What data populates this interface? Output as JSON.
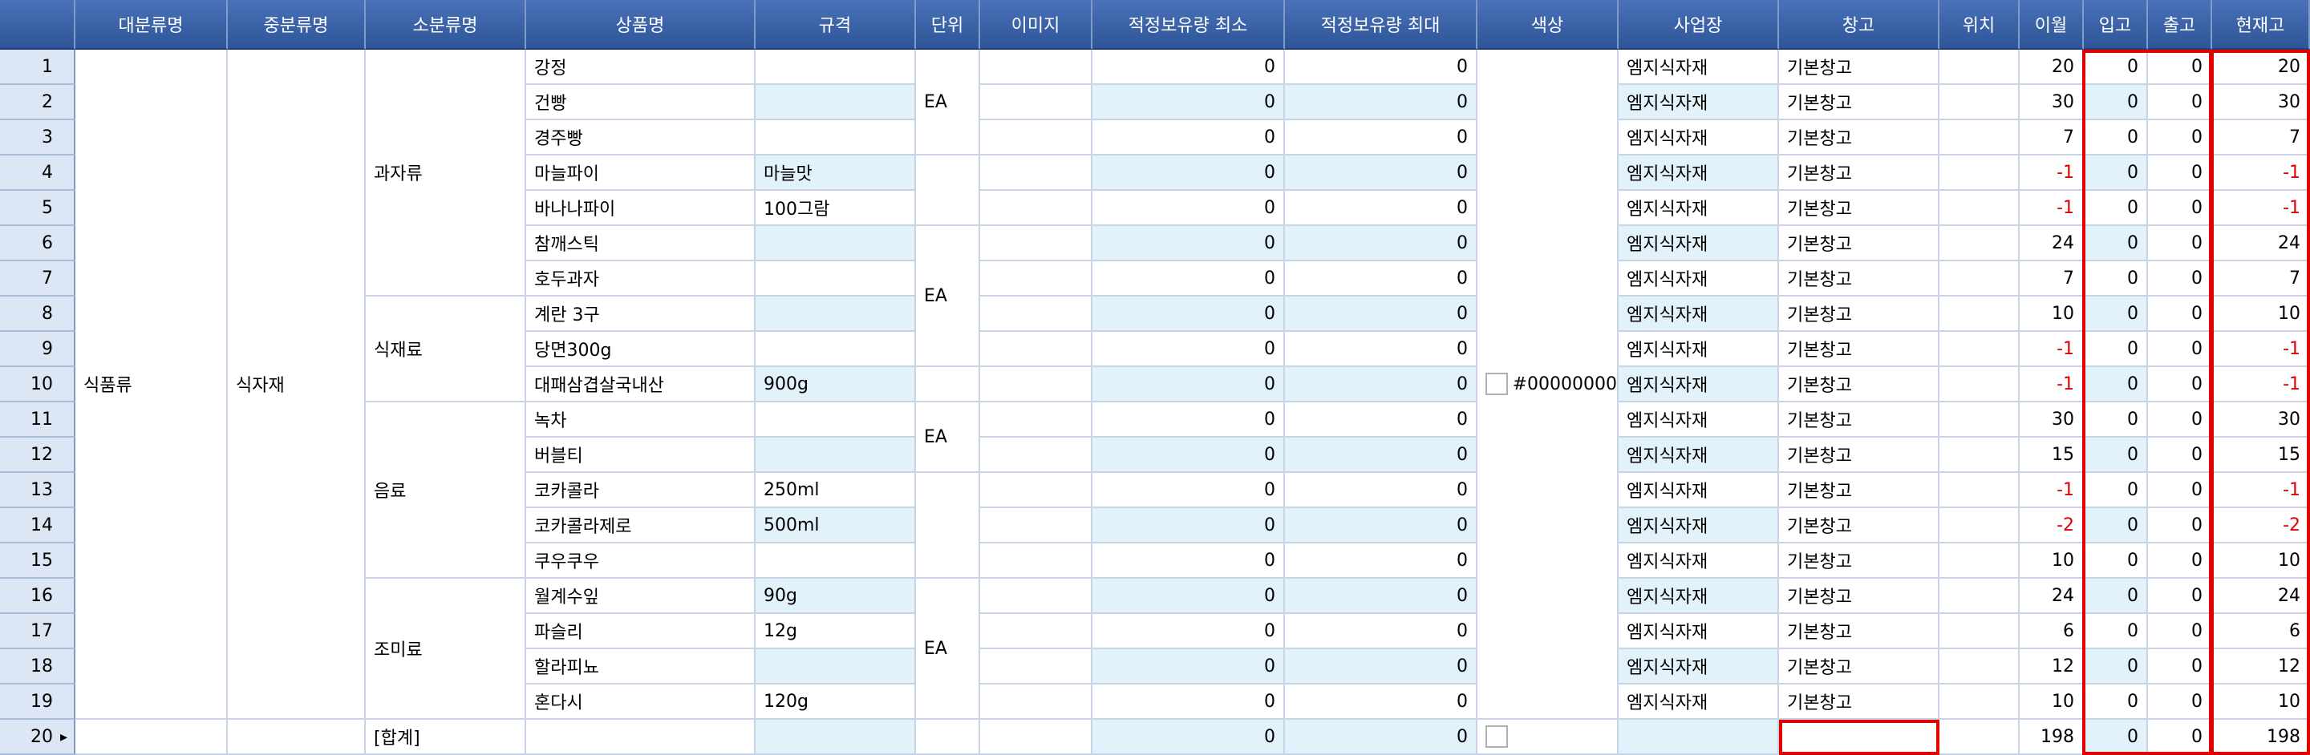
{
  "columns": [
    "대분류명",
    "중분류명",
    "소분류명",
    "상품명",
    "규격",
    "단위",
    "이미지",
    "적정보유량 최소",
    "적정보유량 최대",
    "색상",
    "사업장",
    "창고",
    "위치",
    "이월",
    "입고",
    "출고",
    "현재고"
  ],
  "groups": {
    "major": "식품류",
    "middle": "식자재",
    "minor": [
      "과자류",
      "식재료",
      "음료",
      "조미료"
    ],
    "unit_label": "EA",
    "color_value": "#00000000"
  },
  "rows": [
    {
      "no": "1",
      "name": "강정",
      "spec": "",
      "min": "0",
      "max": "0",
      "site": "엠지식자재",
      "wh": "기본창고",
      "carry": "20",
      "in": "0",
      "out": "0",
      "stock": "20"
    },
    {
      "no": "2",
      "name": "건빵",
      "spec": "",
      "min": "0",
      "max": "0",
      "site": "엠지식자재",
      "wh": "기본창고",
      "carry": "30",
      "in": "0",
      "out": "0",
      "stock": "30"
    },
    {
      "no": "3",
      "name": "경주빵",
      "spec": "",
      "min": "0",
      "max": "0",
      "site": "엠지식자재",
      "wh": "기본창고",
      "carry": "7",
      "in": "0",
      "out": "0",
      "stock": "7"
    },
    {
      "no": "4",
      "name": "마늘파이",
      "spec": "마늘맛",
      "min": "0",
      "max": "0",
      "site": "엠지식자재",
      "wh": "기본창고",
      "carry": "-1",
      "in": "0",
      "out": "0",
      "stock": "-1"
    },
    {
      "no": "5",
      "name": "바나나파이",
      "spec": "100그람",
      "min": "0",
      "max": "0",
      "site": "엠지식자재",
      "wh": "기본창고",
      "carry": "-1",
      "in": "0",
      "out": "0",
      "stock": "-1"
    },
    {
      "no": "6",
      "name": "참깨스틱",
      "spec": "",
      "min": "0",
      "max": "0",
      "site": "엠지식자재",
      "wh": "기본창고",
      "carry": "24",
      "in": "0",
      "out": "0",
      "stock": "24"
    },
    {
      "no": "7",
      "name": "호두과자",
      "spec": "",
      "min": "0",
      "max": "0",
      "site": "엠지식자재",
      "wh": "기본창고",
      "carry": "7",
      "in": "0",
      "out": "0",
      "stock": "7"
    },
    {
      "no": "8",
      "name": "계란 3구",
      "spec": "",
      "min": "0",
      "max": "0",
      "site": "엠지식자재",
      "wh": "기본창고",
      "carry": "10",
      "in": "0",
      "out": "0",
      "stock": "10"
    },
    {
      "no": "9",
      "name": "당면300g",
      "spec": "",
      "min": "0",
      "max": "0",
      "site": "엠지식자재",
      "wh": "기본창고",
      "carry": "-1",
      "in": "0",
      "out": "0",
      "stock": "-1"
    },
    {
      "no": "10",
      "name": "대패삼겹살국내산",
      "spec": "900g",
      "min": "0",
      "max": "0",
      "site": "엠지식자재",
      "wh": "기본창고",
      "carry": "-1",
      "in": "0",
      "out": "0",
      "stock": "-1"
    },
    {
      "no": "11",
      "name": "녹차",
      "spec": "",
      "min": "0",
      "max": "0",
      "site": "엠지식자재",
      "wh": "기본창고",
      "carry": "30",
      "in": "0",
      "out": "0",
      "stock": "30"
    },
    {
      "no": "12",
      "name": "버블티",
      "spec": "",
      "min": "0",
      "max": "0",
      "site": "엠지식자재",
      "wh": "기본창고",
      "carry": "15",
      "in": "0",
      "out": "0",
      "stock": "15"
    },
    {
      "no": "13",
      "name": "코카콜라",
      "spec": "250ml",
      "min": "0",
      "max": "0",
      "site": "엠지식자재",
      "wh": "기본창고",
      "carry": "-1",
      "in": "0",
      "out": "0",
      "stock": "-1"
    },
    {
      "no": "14",
      "name": "코카콜라제로",
      "spec": "500ml",
      "min": "0",
      "max": "0",
      "site": "엠지식자재",
      "wh": "기본창고",
      "carry": "-2",
      "in": "0",
      "out": "0",
      "stock": "-2"
    },
    {
      "no": "15",
      "name": "쿠우쿠우",
      "spec": "",
      "min": "0",
      "max": "0",
      "site": "엠지식자재",
      "wh": "기본창고",
      "carry": "10",
      "in": "0",
      "out": "0",
      "stock": "10"
    },
    {
      "no": "16",
      "name": "월계수잎",
      "spec": "90g",
      "min": "0",
      "max": "0",
      "site": "엠지식자재",
      "wh": "기본창고",
      "carry": "24",
      "in": "0",
      "out": "0",
      "stock": "24"
    },
    {
      "no": "17",
      "name": "파슬리",
      "spec": "12g",
      "min": "0",
      "max": "0",
      "site": "엠지식자재",
      "wh": "기본창고",
      "carry": "6",
      "in": "0",
      "out": "0",
      "stock": "6"
    },
    {
      "no": "18",
      "name": "할라피뇨",
      "spec": "",
      "min": "0",
      "max": "0",
      "site": "엠지식자재",
      "wh": "기본창고",
      "carry": "12",
      "in": "0",
      "out": "0",
      "stock": "12"
    },
    {
      "no": "19",
      "name": "혼다시",
      "spec": "120g",
      "min": "0",
      "max": "0",
      "site": "엠지식자재",
      "wh": "기본창고",
      "carry": "10",
      "in": "0",
      "out": "0",
      "stock": "10"
    }
  ],
  "total": {
    "no": "20",
    "label": "[합계]",
    "min": "0",
    "max": "0",
    "carry": "198",
    "in": "0",
    "out": "0",
    "stock": "198"
  },
  "colors": {
    "header_bg": "#2f5598",
    "alt_row": "#e2f2fa",
    "negative": "#e00000",
    "highlight": "#e00000"
  }
}
